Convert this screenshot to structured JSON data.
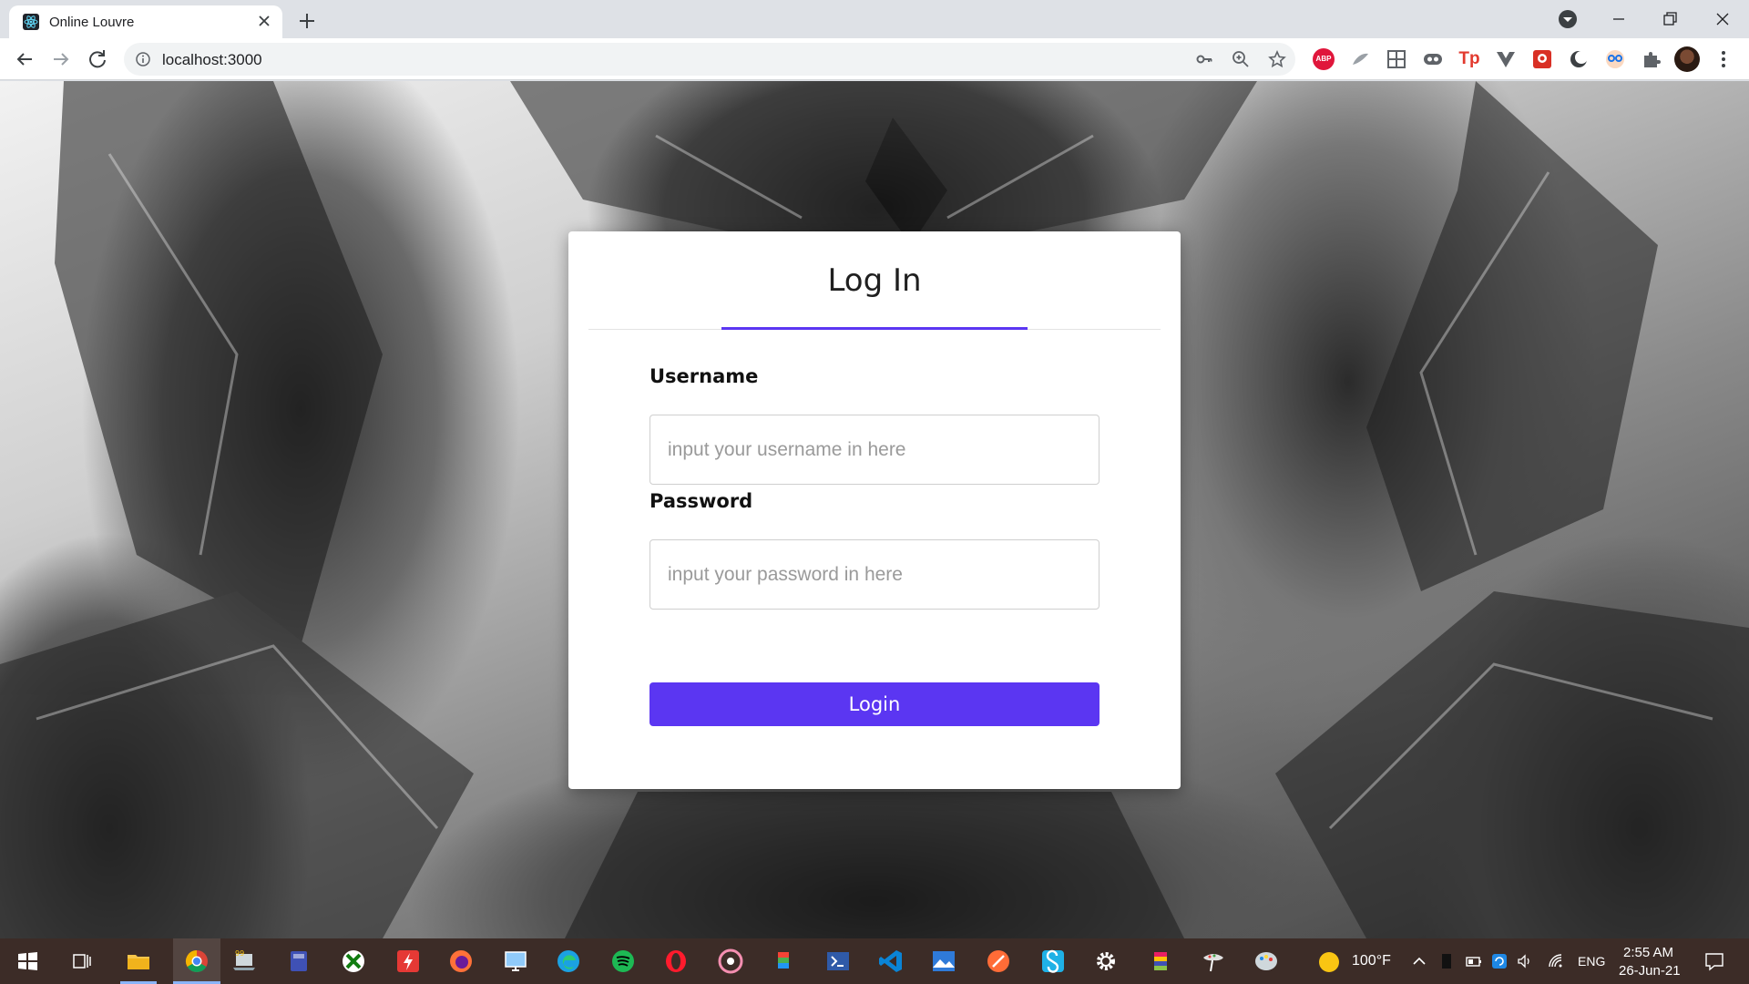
{
  "browser": {
    "tab_title": "Online Louvre",
    "url": "localhost:3000"
  },
  "login": {
    "title": "Log In",
    "username_label": "Username",
    "username_placeholder": "input your username in here",
    "username_value": "",
    "password_label": "Password",
    "password_placeholder": "input your password in here",
    "password_value": "",
    "submit_label": "Login"
  },
  "taskbar": {
    "weather_temp": "100°F",
    "language": "ENG",
    "time": "2:55 AM",
    "date": "26-Jun-21"
  },
  "colors": {
    "accent": "#5b36f2",
    "taskbar": "#3c2c27",
    "tab_strip": "#dee1e6"
  },
  "icons": {
    "browser": [
      "react-favicon",
      "close-icon",
      "plus-icon",
      "profile-dropdown-icon",
      "minimize-icon",
      "restore-icon",
      "window-close-icon",
      "back-arrow-icon",
      "forward-arrow-icon",
      "reload-icon",
      "info-icon",
      "key-icon",
      "zoom-icon",
      "star-icon",
      "extensions-puzzle-icon",
      "kebab-menu-icon"
    ],
    "extensions": [
      "adblock-plus-icon",
      "feather-icon",
      "sheets-icon",
      "infinity-icon",
      "tp-icon",
      "vue-devtools-icon",
      "picture-icon",
      "dark-reader-icon",
      "mask-icon"
    ],
    "taskbar": [
      "windows-start-icon",
      "task-view-icon",
      "file-explorer-icon",
      "chrome-icon",
      "laptop-icon",
      "calculator-icon",
      "xbox-icon",
      "bolt-icon",
      "firefox-icon",
      "monitor-icon",
      "edge-icon",
      "spotify-icon",
      "opera-icon",
      "disc-icon",
      "pages-icon",
      "terminal-icon",
      "vscode-icon",
      "photos-icon",
      "postman-icon",
      "steam-icon",
      "settings-icon",
      "folder-color-icon",
      "paint-icon",
      "art-icon"
    ]
  }
}
